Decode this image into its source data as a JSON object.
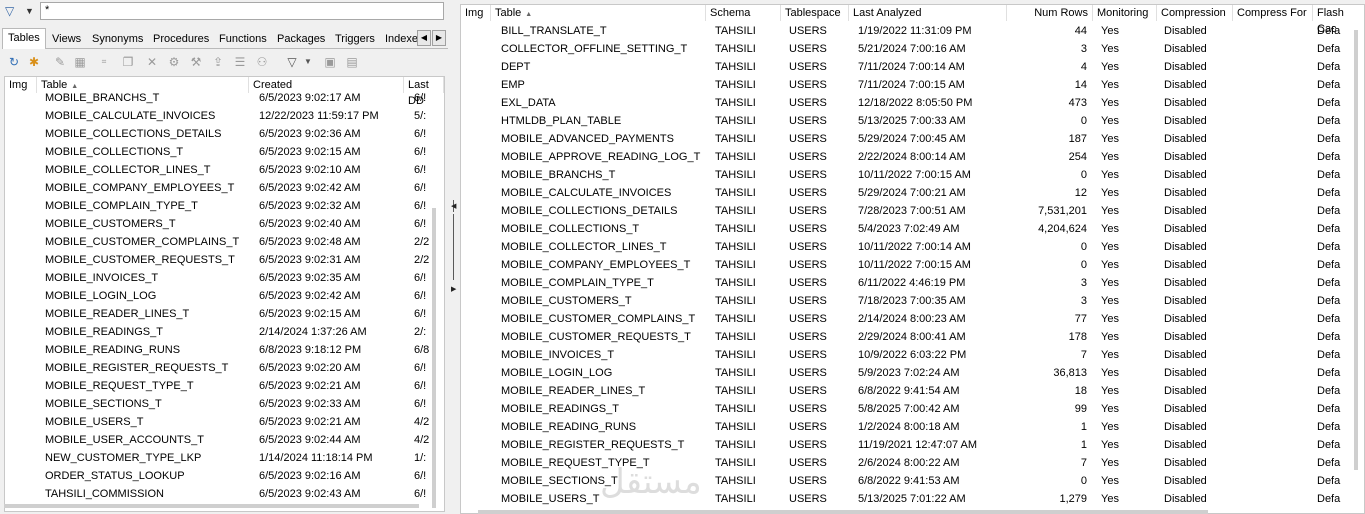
{
  "filter": {
    "value": "*"
  },
  "tabs": [
    "Tables",
    "Views",
    "Synonyms",
    "Procedures",
    "Functions",
    "Packages",
    "Triggers",
    "Indexe"
  ],
  "left_grid": {
    "headers": [
      "Img",
      "Table",
      "Created",
      "Last DD"
    ],
    "rows": [
      [
        "MOBILE_BRANCHS_T",
        "6/5/2023 9:02:17 AM",
        "6/!"
      ],
      [
        "MOBILE_CALCULATE_INVOICES",
        "12/22/2023 11:59:17 PM",
        "5/:"
      ],
      [
        "MOBILE_COLLECTIONS_DETAILS",
        "6/5/2023 9:02:36 AM",
        "6/!"
      ],
      [
        "MOBILE_COLLECTIONS_T",
        "6/5/2023 9:02:15 AM",
        "6/!"
      ],
      [
        "MOBILE_COLLECTOR_LINES_T",
        "6/5/2023 9:02:10 AM",
        "6/!"
      ],
      [
        "MOBILE_COMPANY_EMPLOYEES_T",
        "6/5/2023 9:02:42 AM",
        "6/!"
      ],
      [
        "MOBILE_COMPLAIN_TYPE_T",
        "6/5/2023 9:02:32 AM",
        "6/!"
      ],
      [
        "MOBILE_CUSTOMERS_T",
        "6/5/2023 9:02:40 AM",
        "6/!"
      ],
      [
        "MOBILE_CUSTOMER_COMPLAINS_T",
        "6/5/2023 9:02:48 AM",
        "2/2"
      ],
      [
        "MOBILE_CUSTOMER_REQUESTS_T",
        "6/5/2023 9:02:31 AM",
        "2/2"
      ],
      [
        "MOBILE_INVOICES_T",
        "6/5/2023 9:02:35 AM",
        "6/!"
      ],
      [
        "MOBILE_LOGIN_LOG",
        "6/5/2023 9:02:42 AM",
        "6/!"
      ],
      [
        "MOBILE_READER_LINES_T",
        "6/5/2023 9:02:15 AM",
        "6/!"
      ],
      [
        "MOBILE_READINGS_T",
        "2/14/2024 1:37:26 AM",
        "2/:"
      ],
      [
        "MOBILE_READING_RUNS",
        "6/8/2023 9:18:12 PM",
        "6/8"
      ],
      [
        "MOBILE_REGISTER_REQUESTS_T",
        "6/5/2023 9:02:20 AM",
        "6/!"
      ],
      [
        "MOBILE_REQUEST_TYPE_T",
        "6/5/2023 9:02:21 AM",
        "6/!"
      ],
      [
        "MOBILE_SECTIONS_T",
        "6/5/2023 9:02:33 AM",
        "6/!"
      ],
      [
        "MOBILE_USERS_T",
        "6/5/2023 9:02:21 AM",
        "4/2"
      ],
      [
        "MOBILE_USER_ACCOUNTS_T",
        "6/5/2023 9:02:44 AM",
        "4/2"
      ],
      [
        "NEW_CUSTOMER_TYPE_LKP",
        "1/14/2024 11:18:14 PM",
        "1/:"
      ],
      [
        "ORDER_STATUS_LOOKUP",
        "6/5/2023 9:02:16 AM",
        "6/!"
      ],
      [
        "TAHSILI_COMMISSION",
        "6/5/2023 9:02:43 AM",
        "6/!"
      ]
    ]
  },
  "right_grid": {
    "headers": [
      "Img",
      "Table",
      "Schema",
      "Tablespace",
      "Last Analyzed",
      "Num Rows",
      "Monitoring",
      "Compression",
      "Compress For",
      "Flash Cac"
    ],
    "rows": [
      [
        "BILL_TRANSLATE_T",
        "TAHSILI",
        "USERS",
        "1/19/2022 11:31:09 PM",
        "44",
        "Yes",
        "Disabled",
        "Defa"
      ],
      [
        "COLLECTOR_OFFLINE_SETTING_T",
        "TAHSILI",
        "USERS",
        "5/21/2024 7:00:16 AM",
        "3",
        "Yes",
        "Disabled",
        "Defa"
      ],
      [
        "DEPT",
        "TAHSILI",
        "USERS",
        "7/11/2024 7:00:14 AM",
        "4",
        "Yes",
        "Disabled",
        "Defa"
      ],
      [
        "EMP",
        "TAHSILI",
        "USERS",
        "7/11/2024 7:00:15 AM",
        "14",
        "Yes",
        "Disabled",
        "Defa"
      ],
      [
        "EXL_DATA",
        "TAHSILI",
        "USERS",
        "12/18/2022 8:05:50 PM",
        "473",
        "Yes",
        "Disabled",
        "Defa"
      ],
      [
        "HTMLDB_PLAN_TABLE",
        "TAHSILI",
        "USERS",
        "5/13/2025 7:00:33 AM",
        "0",
        "Yes",
        "Disabled",
        "Defa"
      ],
      [
        "MOBILE_ADVANCED_PAYMENTS",
        "TAHSILI",
        "USERS",
        "5/29/2024 7:00:45 AM",
        "187",
        "Yes",
        "Disabled",
        "Defa"
      ],
      [
        "MOBILE_APPROVE_READING_LOG_T",
        "TAHSILI",
        "USERS",
        "2/22/2024 8:00:14 AM",
        "254",
        "Yes",
        "Disabled",
        "Defa"
      ],
      [
        "MOBILE_BRANCHS_T",
        "TAHSILI",
        "USERS",
        "10/11/2022 7:00:15 AM",
        "0",
        "Yes",
        "Disabled",
        "Defa"
      ],
      [
        "MOBILE_CALCULATE_INVOICES",
        "TAHSILI",
        "USERS",
        "5/29/2024 7:00:21 AM",
        "12",
        "Yes",
        "Disabled",
        "Defa"
      ],
      [
        "MOBILE_COLLECTIONS_DETAILS",
        "TAHSILI",
        "USERS",
        "7/28/2023 7:00:51 AM",
        "7,531,201",
        "Yes",
        "Disabled",
        "Defa"
      ],
      [
        "MOBILE_COLLECTIONS_T",
        "TAHSILI",
        "USERS",
        "5/4/2023 7:02:49 AM",
        "4,204,624",
        "Yes",
        "Disabled",
        "Defa"
      ],
      [
        "MOBILE_COLLECTOR_LINES_T",
        "TAHSILI",
        "USERS",
        "10/11/2022 7:00:14 AM",
        "0",
        "Yes",
        "Disabled",
        "Defa"
      ],
      [
        "MOBILE_COMPANY_EMPLOYEES_T",
        "TAHSILI",
        "USERS",
        "10/11/2022 7:00:15 AM",
        "0",
        "Yes",
        "Disabled",
        "Defa"
      ],
      [
        "MOBILE_COMPLAIN_TYPE_T",
        "TAHSILI",
        "USERS",
        "6/11/2022 4:46:19 PM",
        "3",
        "Yes",
        "Disabled",
        "Defa"
      ],
      [
        "MOBILE_CUSTOMERS_T",
        "TAHSILI",
        "USERS",
        "7/18/2023 7:00:35 AM",
        "3",
        "Yes",
        "Disabled",
        "Defa"
      ],
      [
        "MOBILE_CUSTOMER_COMPLAINS_T",
        "TAHSILI",
        "USERS",
        "2/14/2024 8:00:23 AM",
        "77",
        "Yes",
        "Disabled",
        "Defa"
      ],
      [
        "MOBILE_CUSTOMER_REQUESTS_T",
        "TAHSILI",
        "USERS",
        "2/29/2024 8:00:41 AM",
        "178",
        "Yes",
        "Disabled",
        "Defa"
      ],
      [
        "MOBILE_INVOICES_T",
        "TAHSILI",
        "USERS",
        "10/9/2022 6:03:22 PM",
        "7",
        "Yes",
        "Disabled",
        "Defa"
      ],
      [
        "MOBILE_LOGIN_LOG",
        "TAHSILI",
        "USERS",
        "5/9/2023 7:02:24 AM",
        "36,813",
        "Yes",
        "Disabled",
        "Defa"
      ],
      [
        "MOBILE_READER_LINES_T",
        "TAHSILI",
        "USERS",
        "6/8/2022 9:41:54 AM",
        "18",
        "Yes",
        "Disabled",
        "Defa"
      ],
      [
        "MOBILE_READINGS_T",
        "TAHSILI",
        "USERS",
        "5/8/2025 7:00:42 AM",
        "99",
        "Yes",
        "Disabled",
        "Defa"
      ],
      [
        "MOBILE_READING_RUNS",
        "TAHSILI",
        "USERS",
        "1/2/2024 8:00:18 AM",
        "1",
        "Yes",
        "Disabled",
        "Defa"
      ],
      [
        "MOBILE_REGISTER_REQUESTS_T",
        "TAHSILI",
        "USERS",
        "11/19/2021 12:47:07 AM",
        "1",
        "Yes",
        "Disabled",
        "Defa"
      ],
      [
        "MOBILE_REQUEST_TYPE_T",
        "TAHSILI",
        "USERS",
        "2/6/2024 8:00:22 AM",
        "7",
        "Yes",
        "Disabled",
        "Defa"
      ],
      [
        "MOBILE_SECTIONS_T",
        "TAHSILI",
        "USERS",
        "6/8/2022 9:41:53 AM",
        "0",
        "Yes",
        "Disabled",
        "Defa"
      ],
      [
        "MOBILE_USERS_T",
        "TAHSILI",
        "USERS",
        "5/13/2025 7:01:22 AM",
        "1,279",
        "Yes",
        "Disabled",
        "Defa"
      ]
    ]
  },
  "watermark": "مستقل"
}
